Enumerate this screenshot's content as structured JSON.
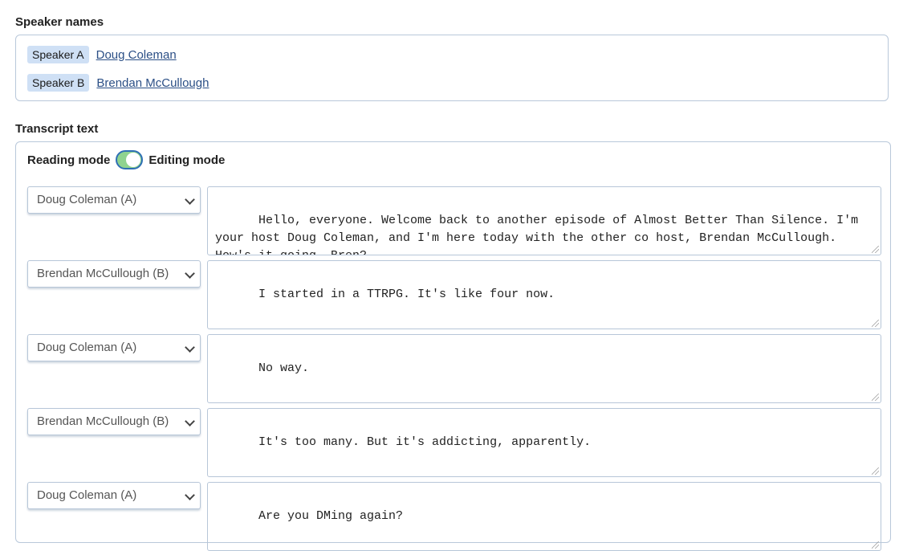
{
  "speaker_names": {
    "title": "Speaker names",
    "speakers": [
      {
        "badge": "Speaker A",
        "name": "Doug Coleman"
      },
      {
        "badge": "Speaker B",
        "name": "Brendan McCullough"
      }
    ]
  },
  "transcript": {
    "title": "Transcript text",
    "mode": {
      "left_label": "Reading mode",
      "right_label": "Editing mode",
      "editing_enabled": true
    },
    "segments": [
      {
        "speaker": "Doug Coleman (A)",
        "text": "Hello, everyone. Welcome back to another episode of Almost Better Than Silence. I'm your host Doug Coleman, and I'm here today with the other co host, Brendan McCullough. How's it going, Bren?"
      },
      {
        "speaker": "Brendan McCullough (B)",
        "text": "I started in a TTRPG. It's like four now."
      },
      {
        "speaker": "Doug Coleman (A)",
        "text": "No way."
      },
      {
        "speaker": "Brendan McCullough (B)",
        "text": "It's too many. But it's addicting, apparently."
      },
      {
        "speaker": "Doug Coleman (A)",
        "text": "Are you DMing again?"
      }
    ]
  },
  "colors": {
    "badge_bg": "#cfe0f5",
    "link": "#2b4f86",
    "toggle_on": "#8fd38f",
    "toggle_border": "#2f6fb5",
    "border": "#b9c8da"
  }
}
